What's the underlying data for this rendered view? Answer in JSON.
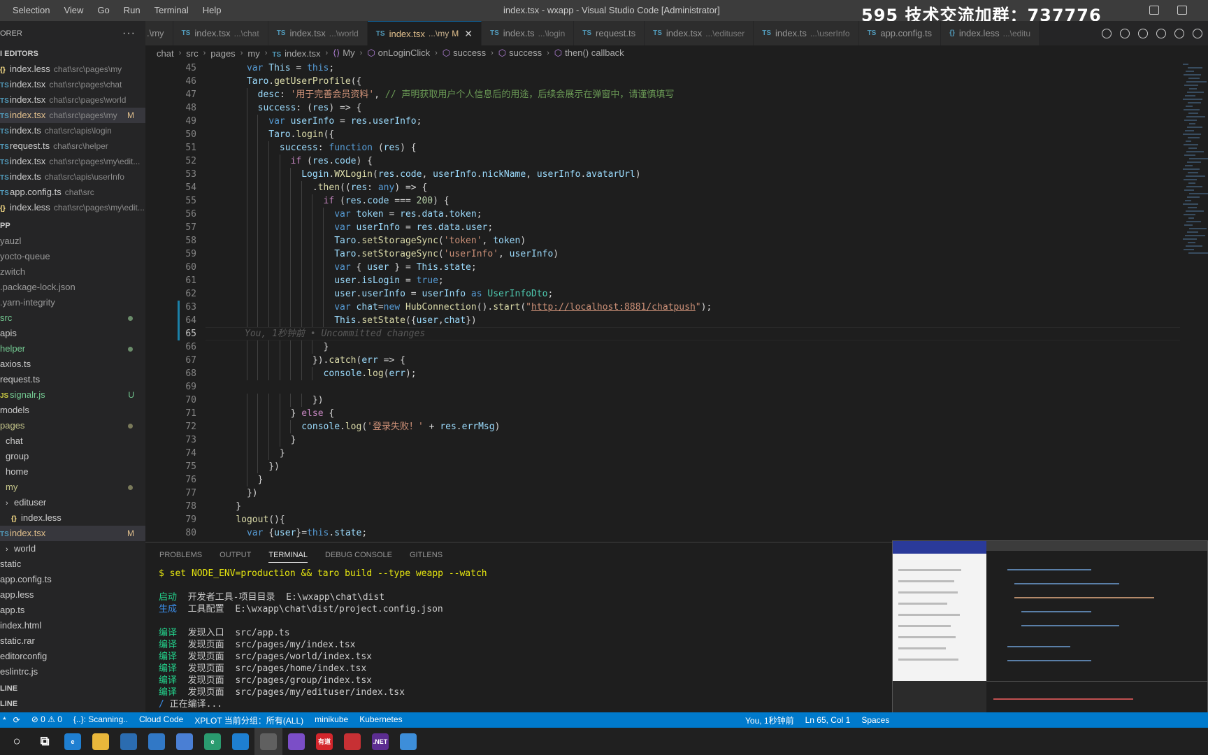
{
  "window": {
    "title": "index.tsx - wxapp - Visual Studio Code [Administrator]",
    "overlay_text": "595 技术交流加群：737776"
  },
  "menu": [
    "Selection",
    "View",
    "Go",
    "Run",
    "Terminal",
    "Help"
  ],
  "sidebar": {
    "header": "ORER",
    "open_editors_title": "I EDITORS",
    "open_editors": [
      {
        "icon": "{}",
        "name": "index.less",
        "path": "chat\\src\\pages\\my",
        "badge": ""
      },
      {
        "icon": "TS",
        "name": "index.tsx",
        "path": "chat\\src\\pages\\chat",
        "badge": ""
      },
      {
        "icon": "TS",
        "name": "index.tsx",
        "path": "chat\\src\\pages\\world",
        "badge": ""
      },
      {
        "icon": "TS",
        "name": "index.tsx",
        "path": "chat\\src\\pages\\my",
        "badge": "M"
      },
      {
        "icon": "TS",
        "name": "index.ts",
        "path": "chat\\src\\apis\\login",
        "badge": ""
      },
      {
        "icon": "TS",
        "name": "request.ts",
        "path": "chat\\src\\helper",
        "badge": ""
      },
      {
        "icon": "TS",
        "name": "index.tsx",
        "path": "chat\\src\\pages\\my\\edit...",
        "badge": ""
      },
      {
        "icon": "TS",
        "name": "index.ts",
        "path": "chat\\src\\apis\\userInfo",
        "badge": ""
      },
      {
        "icon": "TS",
        "name": "app.config.ts",
        "path": "chat\\src",
        "badge": ""
      },
      {
        "icon": "{}",
        "name": "index.less",
        "path": "chat\\src\\pages\\my\\edit...",
        "badge": ""
      }
    ],
    "project_title": "PP",
    "tree": [
      {
        "name": "yauzl",
        "icon": "",
        "badge": ""
      },
      {
        "name": "yocto-queue",
        "icon": "",
        "badge": ""
      },
      {
        "name": "zwitch",
        "icon": "",
        "badge": ""
      },
      {
        "name": ".package-lock.json",
        "icon": "",
        "badge": ""
      },
      {
        "name": ".yarn-integrity",
        "icon": "",
        "badge": ""
      },
      {
        "name": "src",
        "icon": "",
        "badge": "dot"
      },
      {
        "name": "apis",
        "icon": "",
        "badge": ""
      },
      {
        "name": "helper",
        "icon": "",
        "badge": "dot"
      },
      {
        "name": "axios.ts",
        "icon": "",
        "badge": ""
      },
      {
        "name": "request.ts",
        "icon": "",
        "badge": ""
      },
      {
        "name": "signalr.js",
        "icon": "JS",
        "badge": "U"
      },
      {
        "name": "models",
        "icon": "",
        "badge": ""
      },
      {
        "name": "pages",
        "icon": "",
        "badge": "dot"
      },
      {
        "name": "chat",
        "icon": "",
        "badge": ""
      },
      {
        "name": "group",
        "icon": "",
        "badge": ""
      },
      {
        "name": "home",
        "icon": "",
        "badge": ""
      },
      {
        "name": "my",
        "icon": "",
        "badge": "dot"
      },
      {
        "name": "edituser",
        "icon": ">",
        "badge": ""
      },
      {
        "name": "index.less",
        "icon": "{}",
        "badge": ""
      },
      {
        "name": "index.tsx",
        "icon": "TS",
        "badge": "M"
      },
      {
        "name": "world",
        "icon": ">",
        "badge": ""
      },
      {
        "name": "static",
        "icon": "",
        "badge": ""
      },
      {
        "name": "app.config.ts",
        "icon": "",
        "badge": ""
      },
      {
        "name": "app.less",
        "icon": "",
        "badge": ""
      },
      {
        "name": "app.ts",
        "icon": "",
        "badge": ""
      },
      {
        "name": "index.html",
        "icon": "",
        "badge": ""
      },
      {
        "name": "static.rar",
        "icon": "",
        "badge": ""
      },
      {
        "name": "editorconfig",
        "icon": "",
        "badge": ""
      },
      {
        "name": "eslintrc.js",
        "icon": "",
        "badge": ""
      }
    ],
    "outline_title": "LINE",
    "timeline_title": "LINE"
  },
  "tabs": [
    {
      "icon": "",
      "name": ".\\my",
      "desc": "",
      "flag": ""
    },
    {
      "icon": "TS",
      "name": "index.tsx",
      "desc": "...\\chat",
      "flag": ""
    },
    {
      "icon": "TS",
      "name": "index.tsx",
      "desc": "...\\world",
      "flag": ""
    },
    {
      "icon": "TS",
      "name": "index.tsx",
      "desc": "...\\my",
      "flag": "M"
    },
    {
      "icon": "TS",
      "name": "index.ts",
      "desc": "...\\login",
      "flag": ""
    },
    {
      "icon": "TS",
      "name": "request.ts",
      "desc": "",
      "flag": ""
    },
    {
      "icon": "TS",
      "name": "index.tsx",
      "desc": "...\\edituser",
      "flag": ""
    },
    {
      "icon": "TS",
      "name": "index.ts",
      "desc": "...\\userInfo",
      "flag": ""
    },
    {
      "icon": "TS",
      "name": "app.config.ts",
      "desc": "",
      "flag": ""
    },
    {
      "icon": "{}",
      "name": "index.less",
      "desc": "...\\editu",
      "flag": ""
    }
  ],
  "breadcrumb": [
    "chat",
    "src",
    "pages",
    "my",
    "index.tsx",
    "My",
    "onLoginClick",
    "success",
    "success",
    "then() callback"
  ],
  "editor": {
    "current_line": 65,
    "lines": [
      {
        "n": 45,
        "text": "      var This = this;"
      },
      {
        "n": 46,
        "text": "      Taro.getUserProfile({"
      },
      {
        "n": 47,
        "text": "        desc: '用于完善会员资料', // 声明获取用户个人信息后的用途，后续会展示在弹窗中，请谨慎填写"
      },
      {
        "n": 48,
        "text": "        success: (res) => {"
      },
      {
        "n": 49,
        "text": "          var userInfo = res.userInfo;"
      },
      {
        "n": 50,
        "text": "          Taro.login({"
      },
      {
        "n": 51,
        "text": "            success: function (res) {"
      },
      {
        "n": 52,
        "text": "              if (res.code) {"
      },
      {
        "n": 53,
        "text": "                Login.WXLogin(res.code, userInfo.nickName, userInfo.avatarUrl)"
      },
      {
        "n": 54,
        "text": "                  .then((res: any) => {"
      },
      {
        "n": 55,
        "text": "                    if (res.code === 200) {"
      },
      {
        "n": 56,
        "text": "                      var token = res.data.token;"
      },
      {
        "n": 57,
        "text": "                      var userInfo = res.data.user;"
      },
      {
        "n": 58,
        "text": "                      Taro.setStorageSync('token', token)"
      },
      {
        "n": 59,
        "text": "                      Taro.setStorageSync('userInfo', userInfo)"
      },
      {
        "n": 60,
        "text": "                      var { user } = This.state;"
      },
      {
        "n": 61,
        "text": "                      user.isLogin = true;"
      },
      {
        "n": 62,
        "text": "                      user.userInfo = userInfo as UserInfoDto;"
      },
      {
        "n": 63,
        "text": "                      var chat=new HubConnection().start(\"http://localhost:8881/chatpush\");"
      },
      {
        "n": 64,
        "text": "                      This.setState({user,chat})"
      },
      {
        "n": 65,
        "text": "",
        "blame": "You, 1秒钟前 • Uncommitted changes"
      },
      {
        "n": 66,
        "text": "                    }"
      },
      {
        "n": 67,
        "text": "                  }).catch(err => {"
      },
      {
        "n": 68,
        "text": "                    console.log(err);"
      },
      {
        "n": 69,
        "text": ""
      },
      {
        "n": 70,
        "text": "                  })"
      },
      {
        "n": 71,
        "text": "              } else {"
      },
      {
        "n": 72,
        "text": "                console.log('登录失败！' + res.errMsg)"
      },
      {
        "n": 73,
        "text": "              }"
      },
      {
        "n": 74,
        "text": "            }"
      },
      {
        "n": 75,
        "text": "          })"
      },
      {
        "n": 76,
        "text": "        }"
      },
      {
        "n": 77,
        "text": "      })"
      },
      {
        "n": 78,
        "text": "    }"
      },
      {
        "n": 79,
        "text": "    logout(){"
      },
      {
        "n": 80,
        "text": "      var {user}=this.state;"
      }
    ]
  },
  "panel": {
    "tabs": [
      "PROBLEMS",
      "OUTPUT",
      "TERMINAL",
      "DEBUG CONSOLE",
      "GITLENS"
    ],
    "active_tab": "TERMINAL",
    "terminal": [
      {
        "tag": "",
        "text": "$ set NODE_ENV=production && taro build --type weapp --watch",
        "style": "cmd"
      },
      {
        "tag": "",
        "text": "",
        "style": "blank"
      },
      {
        "tag": "启动",
        "text": "  开发者工具-项目目录  E:\\wxapp\\chat\\dist",
        "style": "green"
      },
      {
        "tag": "生成",
        "text": "  工具配置  E:\\wxapp\\chat\\dist/project.config.json",
        "style": "blue"
      },
      {
        "tag": "",
        "text": "",
        "style": "blank"
      },
      {
        "tag": "编译",
        "text": "  发现入口  src/app.ts",
        "style": "green"
      },
      {
        "tag": "编译",
        "text": "  发现页面  src/pages/my/index.tsx",
        "style": "green"
      },
      {
        "tag": "编译",
        "text": "  发现页面  src/pages/world/index.tsx",
        "style": "green"
      },
      {
        "tag": "编译",
        "text": "  发现页面  src/pages/home/index.tsx",
        "style": "green"
      },
      {
        "tag": "编译",
        "text": "  发现页面  src/pages/group/index.tsx",
        "style": "green"
      },
      {
        "tag": "编译",
        "text": "  发现页面  src/pages/my/edituser/index.tsx",
        "style": "green"
      },
      {
        "tag": "/",
        "text": " 正在编译...",
        "style": "progress"
      }
    ]
  },
  "statusbar": {
    "left": [
      "⊘ 0 ⚠ 0",
      "{..}: Scanning..",
      "Cloud Code",
      "XPLOT 当前分组：所有(ALL)",
      "minikube",
      "Kubernetes"
    ],
    "right": [
      "You, 1秒钟前",
      "Ln 65, Col 1",
      "Spaces"
    ]
  },
  "taskbar": [
    {
      "name": "search",
      "label": "○",
      "color": "#202020"
    },
    {
      "name": "task-view",
      "label": "⧉",
      "color": "#202020"
    },
    {
      "name": "edge",
      "label": "e",
      "color": "#1f7fd1"
    },
    {
      "name": "file-explorer",
      "label": "",
      "color": "#e9b73b"
    },
    {
      "name": "store",
      "label": "",
      "color": "#2b6cb0"
    },
    {
      "name": "mail",
      "label": "",
      "color": "#3178c6"
    },
    {
      "name": "app-bird",
      "label": "",
      "color": "#4a7fd4"
    },
    {
      "name": "edge-dev",
      "label": "e",
      "color": "#2a9b6f"
    },
    {
      "name": "vscode",
      "label": "",
      "color": "#1e7fd1"
    },
    {
      "name": "wechat",
      "label": "",
      "color": "#606060"
    },
    {
      "name": "visual-studio",
      "label": "",
      "color": "#7b4ec7"
    },
    {
      "name": "youdao",
      "label": "有道",
      "color": "#d3262c"
    },
    {
      "name": "app-red",
      "label": "",
      "color": "#c73034"
    },
    {
      "name": "dotnet",
      "label": ".NET",
      "color": "#5c2d91"
    },
    {
      "name": "app-tool",
      "label": "",
      "color": "#3d8ed9"
    }
  ]
}
